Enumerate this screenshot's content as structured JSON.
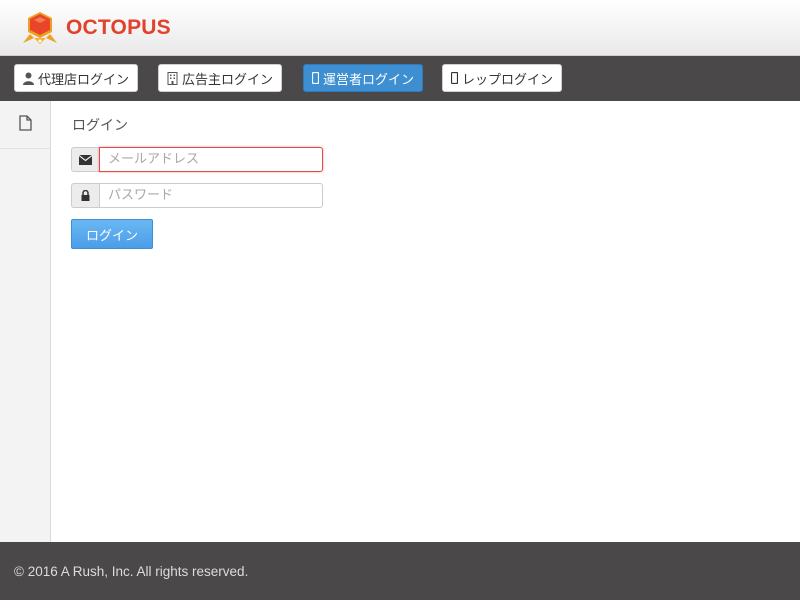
{
  "header": {
    "brand": "OCTOPUS",
    "brand_color": "#e2412b",
    "logo_icon": "octopus-logo"
  },
  "nav": {
    "items": [
      {
        "label": "代理店ログイン",
        "icon": "user-icon",
        "active": false
      },
      {
        "label": "広告主ログイン",
        "icon": "building-icon",
        "active": false
      },
      {
        "label": "運営者ログイン",
        "icon": "mobile-icon",
        "active": true
      },
      {
        "label": "レップログイン",
        "icon": "mobile-icon",
        "active": false
      }
    ],
    "active_color": "#3d8fd1"
  },
  "sidebar": {
    "items": [
      {
        "icon": "file-icon"
      }
    ]
  },
  "login": {
    "title": "ログイン",
    "email_placeholder": "メールアドレス",
    "email_value": "",
    "password_placeholder": "パスワード",
    "password_value": "",
    "submit_label": "ログイン"
  },
  "footer": {
    "copyright": "© 2016 A Rush, Inc. All rights reserved."
  }
}
